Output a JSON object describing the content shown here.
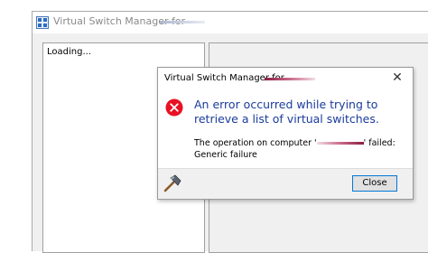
{
  "main_window": {
    "title": "Virtual Switch Manager for",
    "loading_text": "Loading..."
  },
  "dialog": {
    "title": "Virtual Switch Manager for",
    "close_glyph": "✕",
    "error_heading": "An error occurred while trying to retrieve a list of virtual switches.",
    "error_detail_prefix": "The operation on computer '",
    "error_detail_suffix": "' failed: Generic failure",
    "close_button_label": "Close"
  },
  "icons": {
    "app": "virtual-switch-manager-icon",
    "error": "error-icon",
    "hammer": "hammer-icon"
  },
  "colors": {
    "error_heading": "#1a3b9c",
    "error_icon": "#e81123",
    "button_focus_border": "#0078d7",
    "redaction": "#8b1e3f"
  }
}
